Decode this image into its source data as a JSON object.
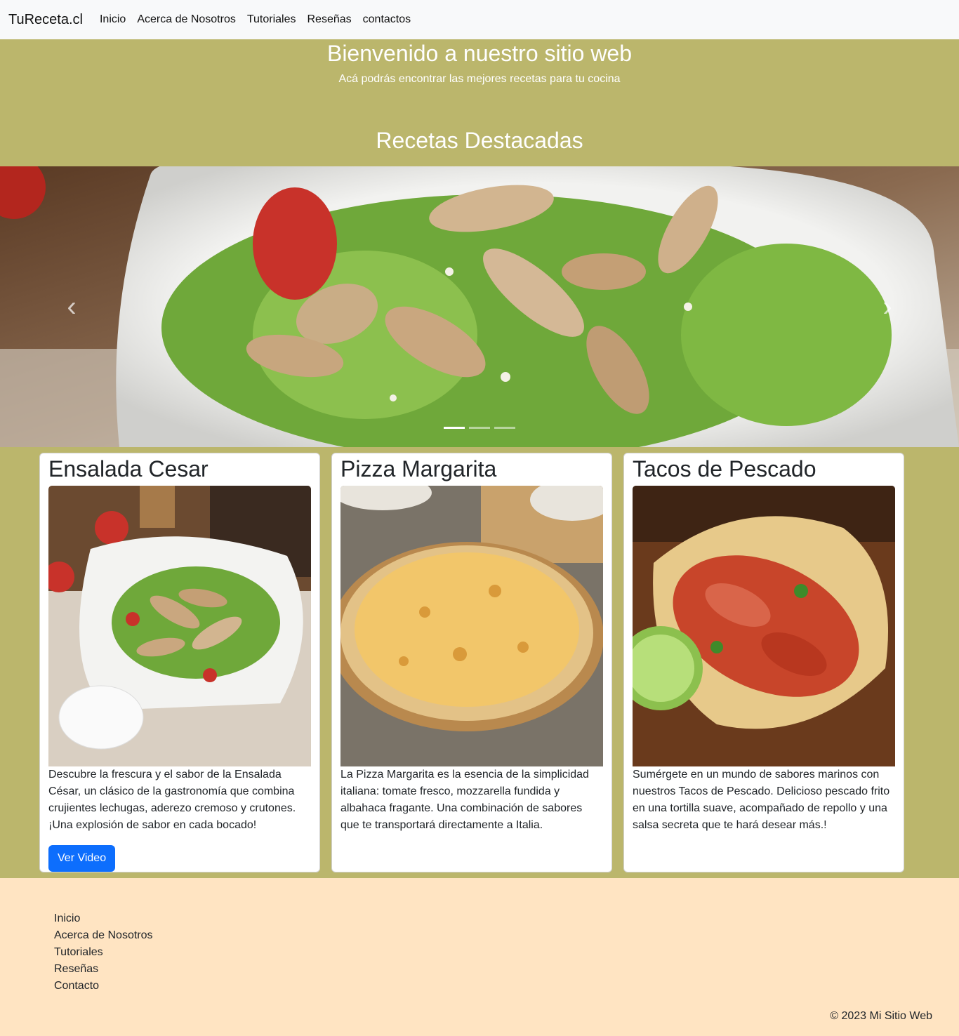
{
  "navbar": {
    "brand": "TuReceta.cl",
    "links": [
      "Inicio",
      "Acerca de Nosotros",
      "Tutoriales",
      "Reseñas",
      "contactos"
    ]
  },
  "hero": {
    "title": "Bienvenido a nuestro sitio web",
    "subtitle": "Acá podrás encontrar las mejores recetas para tu cocina"
  },
  "featured": {
    "title": "Recetas Destacadas",
    "carousel": {
      "prev_icon": "chevron-left-icon",
      "next_icon": "chevron-right-icon",
      "slide_count": 3,
      "active_slide": 1
    }
  },
  "cards": [
    {
      "title": "Ensalada Cesar",
      "text": "Descubre la frescura y el sabor de la Ensalada César, un clásico de la gastronomía que combina crujientes lechugas, aderezo cremoso y crutones. ¡Una explosión de sabor en cada bocado!",
      "button": "Ver Video"
    },
    {
      "title": "Pizza Margarita",
      "text": "La Pizza Margarita es la esencia de la simplicidad italiana: tomate fresco, mozzarella fundida y albahaca fragante. Una combinación de sabores que te transportará directamente a Italia."
    },
    {
      "title": "Tacos de Pescado",
      "text": "Sumérgete en un mundo de sabores marinos con nuestros Tacos de Pescado. Delicioso pescado frito en una tortilla suave, acompañado de repollo y una salsa secreta que te hará desear más.!"
    }
  ],
  "footer": {
    "links": [
      "Inicio",
      "Acerca de Nosotros",
      "Tutoriales",
      "Reseñas",
      "Contacto"
    ],
    "copyright": "© 2023 Mi Sitio Web"
  },
  "colors": {
    "page_bg": "#bbb66c",
    "navbar_bg": "#f8f9fa",
    "footer_bg": "#ffe4c2",
    "button_primary": "#0d6efd"
  }
}
